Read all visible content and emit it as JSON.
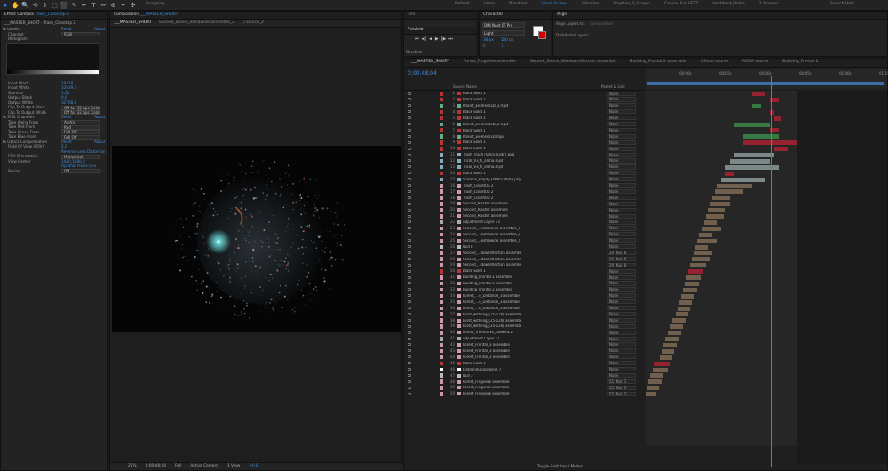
{
  "toolbar": {
    "tools": [
      "▸",
      "✋",
      "🔍",
      "⟲",
      "⇕",
      "⬚",
      "⬛",
      "✎",
      "✒",
      "T",
      "✏",
      "⊕",
      "✦",
      "✣"
    ],
    "snapping": "Snapping",
    "workspaces": [
      "Default",
      "Learn",
      "Standard",
      "Small Screen",
      "Libraries",
      "Stephan_3_Screen",
      "Canvas Full UEFT",
      "Hochkant_Video",
      "2 Screens"
    ],
    "active_workspace": "Small Screen",
    "search": "Search Help"
  },
  "effect_controls": {
    "tab": "Effect Controls",
    "layer": "Trash_ClosetUp 2",
    "breadcrumb": "___MASTER_SHORT - Trash_ClosetUp 2",
    "rows": [
      {
        "l": "fx  Levels",
        "v": "Reset",
        "x": "About"
      },
      {
        "l": "Channel:",
        "v": "RGB",
        "dd": true
      },
      {
        "l": "Histogram",
        "v": ""
      },
      {
        "l": "Input Black",
        "v": "10418"
      },
      {
        "l": "Input White",
        "v": "32639.5"
      },
      {
        "l": "Gamma",
        "v": "1,00"
      },
      {
        "l": "Output Black",
        "v": "0,0"
      },
      {
        "l": "Output White",
        "v": "32768,0"
      },
      {
        "l": "Clip To Output Black",
        "v": "Off for 32 bpc Color",
        "dd": true
      },
      {
        "l": "Clip To Output White",
        "v": "Off for 32 bpc Color",
        "dd": true
      },
      {
        "l": "fx  Shift Channels",
        "v": "Reset",
        "x": "About"
      },
      {
        "l": "Take Alpha From",
        "v": "Alpha",
        "dd": true
      },
      {
        "l": "Take Red From",
        "v": "Red",
        "dd": true
      },
      {
        "l": "Take Green From",
        "v": "Full Off",
        "dd": true
      },
      {
        "l": "Take Blue From",
        "v": "Full Off",
        "dd": true
      },
      {
        "l": "fx  Optics Compensation",
        "v": "Reset",
        "x": "About"
      },
      {
        "l": "Field Of View (FOV)",
        "v": "2,0"
      },
      {
        "l": "",
        "v": "Reverse Lens Distortion",
        "cb": true
      },
      {
        "l": "FOV Orientation",
        "v": "Horizontal",
        "dd": true
      },
      {
        "l": "View Center",
        "v": "1440,1080,0"
      },
      {
        "l": "",
        "v": "Optimal Pixels (Inv",
        "cb": true
      },
      {
        "l": "Resize",
        "v": "Off",
        "dd": true
      }
    ]
  },
  "composition": {
    "tab": "Composition",
    "name": "___MASTER_SHORT",
    "subtabs": [
      "___MASTER_SHORT",
      "Second_Scene_extrawide assemble_2",
      "[] source_2"
    ],
    "footer": {
      "zoom": "25%",
      "time": "0;00;48;04",
      "res": "Full",
      "camera": "Active Camera",
      "view": "1 View",
      "offset": "+0,0"
    }
  },
  "info": {
    "tab": "Info"
  },
  "preview": {
    "tab": "Preview",
    "shortcut": "Shortcut",
    "controls": [
      "⏮",
      "◀|",
      "◀",
      "▶",
      "|▶",
      "⏭"
    ]
  },
  "character": {
    "tab": "Character",
    "font": "DIN Next LT Pro",
    "style": "Light",
    "size": "36 px",
    "leading": "100 px",
    "tracking": "0",
    "vscale": "0"
  },
  "align": {
    "tab": "Align",
    "align_layers_to": "Align Layers to:",
    "target": "Composition",
    "distribute": "Distribute Layers:"
  },
  "timeline": {
    "tabs": [
      "___MASTER_SHORT",
      "Forest_Frogview assemble",
      "Second_Scene_Windowreflection assemble",
      "Building_Frontal 2 assemble",
      "diffuse source",
      "RGBA source",
      "Building_Frontal 2"
    ],
    "timecode": "0;00;48;04",
    "col_source": "Source Name",
    "col_parent": "Parent & Link",
    "toggle": "Toggle Switches / Modes",
    "ruler": [
      "00:00s",
      "00:15s",
      "00:30s",
      "00:45s",
      "01:00s",
      "01:15s"
    ],
    "layers": [
      {
        "n": "1",
        "name": "Black Solid 1",
        "c": "#b33",
        "p": "None"
      },
      {
        "n": "2",
        "name": "Black Solid 1",
        "c": "#b33",
        "p": "None"
      },
      {
        "n": "3",
        "name": "Planet_Element3D_3.mp4",
        "c": "#6a8",
        "p": "None"
      },
      {
        "n": "4",
        "name": "Black Solid 1",
        "c": "#b33",
        "p": "None"
      },
      {
        "n": "5",
        "name": "Black Solid 1",
        "c": "#b33",
        "p": "None"
      },
      {
        "n": "6",
        "name": "Planet_Element3D_2.mp4",
        "c": "#6a8",
        "p": "None"
      },
      {
        "n": "7",
        "name": "Black Solid 1",
        "c": "#b33",
        "p": "None"
      },
      {
        "n": "8",
        "name": "Planet_Element3D.mp4",
        "c": "#6a8",
        "p": "None"
      },
      {
        "n": "9",
        "name": "Black Solid 1",
        "c": "#b33",
        "p": "None"
      },
      {
        "n": "10",
        "name": "Black Solid 1",
        "c": "#b33",
        "p": "None"
      },
      {
        "n": "11",
        "name": "Trash_Trash [0001-0347].png",
        "c": "#8ab",
        "p": "None"
      },
      {
        "n": "12",
        "name": "Tricol_V3_h_alpha.mp4",
        "c": "#8ab",
        "p": "None"
      },
      {
        "n": "13",
        "name": "Tricol_V3_h_alpha.mp4",
        "c": "#8ab",
        "p": "None"
      },
      {
        "n": "14",
        "name": "Black Solid 1",
        "c": "#b33",
        "p": "None"
      },
      {
        "n": "15",
        "name": "Screens_Empty [0000-0499].png",
        "c": "#8ab",
        "p": "None"
      },
      {
        "n": "16",
        "name": "Trash_ClosetUp 2",
        "c": "#c9a",
        "p": "None"
      },
      {
        "n": "17",
        "name": "Trash_ClosetUp 2",
        "c": "#c9a",
        "p": "None"
      },
      {
        "n": "18",
        "name": "Trash_ClosetUp 2",
        "c": "#c9a",
        "p": "None"
      },
      {
        "n": "19",
        "name": "Second_Master assemble",
        "c": "#c9a",
        "p": "None"
      },
      {
        "n": "20",
        "name": "Second_Master assemble",
        "c": "#c9a",
        "p": "None"
      },
      {
        "n": "21",
        "name": "Second_Master assemble",
        "c": "#c9a",
        "p": "None"
      },
      {
        "n": "22",
        "name": "Adjustment Layer 13",
        "c": "#aaa",
        "p": "None"
      },
      {
        "n": "23",
        "name": "Second_...extrawide assemble_2",
        "c": "#c9a",
        "p": "None"
      },
      {
        "n": "24",
        "name": "Second_...extrawide assemble_2",
        "c": "#c9a",
        "p": "None"
      },
      {
        "n": "25",
        "name": "Second_...extrawide assemble_2",
        "c": "#c9a",
        "p": "None"
      },
      {
        "n": "26",
        "name": "Null 8",
        "c": "#bbb",
        "p": "None"
      },
      {
        "n": "27",
        "name": "Second_...dowreflection assemble",
        "c": "#c9a",
        "p": "29. Null 8"
      },
      {
        "n": "28",
        "name": "Second_...dowreflection assemble",
        "c": "#c9a",
        "p": "29. Null 8"
      },
      {
        "n": "29",
        "name": "Second_...dowreflection assemble",
        "c": "#c9a",
        "p": "29. Null 8"
      },
      {
        "n": "30",
        "name": "Black Solid 1",
        "c": "#b33",
        "p": "None"
      },
      {
        "n": "31",
        "name": "Building_Frontal 2 assemble",
        "c": "#c9a",
        "p": "None"
      },
      {
        "n": "32",
        "name": "Building_Frontal 2 assemble",
        "c": "#c9a",
        "p": "None"
      },
      {
        "n": "33",
        "name": "Building_Frontal 2 assemble",
        "c": "#c9a",
        "p": "None"
      },
      {
        "n": "34",
        "name": "Forest_...e_Distance_3 assemble",
        "c": "#c9a",
        "p": "None"
      },
      {
        "n": "35",
        "name": "Forest_...e_Distance_3 assemble",
        "c": "#c9a",
        "p": "None"
      },
      {
        "n": "36",
        "name": "Forest_...e_Distance_3 assemble",
        "c": "#c9a",
        "p": "None"
      },
      {
        "n": "37",
        "name": "Forst_withFog_[25-126] assemble",
        "c": "#c9a",
        "p": "None"
      },
      {
        "n": "38",
        "name": "Forst_withFog_[25-126] assemble",
        "c": "#c9a",
        "p": "None"
      },
      {
        "n": "39",
        "name": "Forst_withFog_[25-126] assemble",
        "c": "#c9a",
        "p": "None"
      },
      {
        "n": "40",
        "name": "Forest_Treemarks_UNREAL 2",
        "c": "#c9a",
        "p": "None"
      },
      {
        "n": "41",
        "name": "Adjustment Layer 11",
        "c": "#aaa",
        "p": "None"
      },
      {
        "n": "42",
        "name": "Forest_Frontal_3 assemble",
        "c": "#c9a",
        "p": "None"
      },
      {
        "n": "43",
        "name": "Forest_Frontal_3 assemble",
        "c": "#c9a",
        "p": "None"
      },
      {
        "n": "44",
        "name": "Forest_Frontal_3 assemble",
        "c": "#c9a",
        "p": "None"
      },
      {
        "n": "45",
        "name": "Black Solid 1",
        "c": "#b33",
        "p": "None"
      },
      {
        "n": "46",
        "name": "Einblendungsebene 7",
        "c": "#fff",
        "p": "None"
      },
      {
        "n": "47",
        "name": "Null 3",
        "c": "#bbb",
        "p": "None"
      },
      {
        "n": "48",
        "name": "Forest_Frogview assemble",
        "c": "#c9a",
        "p": "55. Null 3"
      },
      {
        "n": "49",
        "name": "Forest_Frogview assemble",
        "c": "#c9a",
        "p": "55. Null 3"
      },
      {
        "n": "50",
        "name": "Forest_Frogview assemble",
        "c": "#c9a",
        "p": "55. Null 3"
      }
    ]
  },
  "colors": {
    "accent": "#2d8ceb",
    "value_blue": "#3a8fe0",
    "panel": "#232323",
    "clip": "#7f6b55"
  }
}
